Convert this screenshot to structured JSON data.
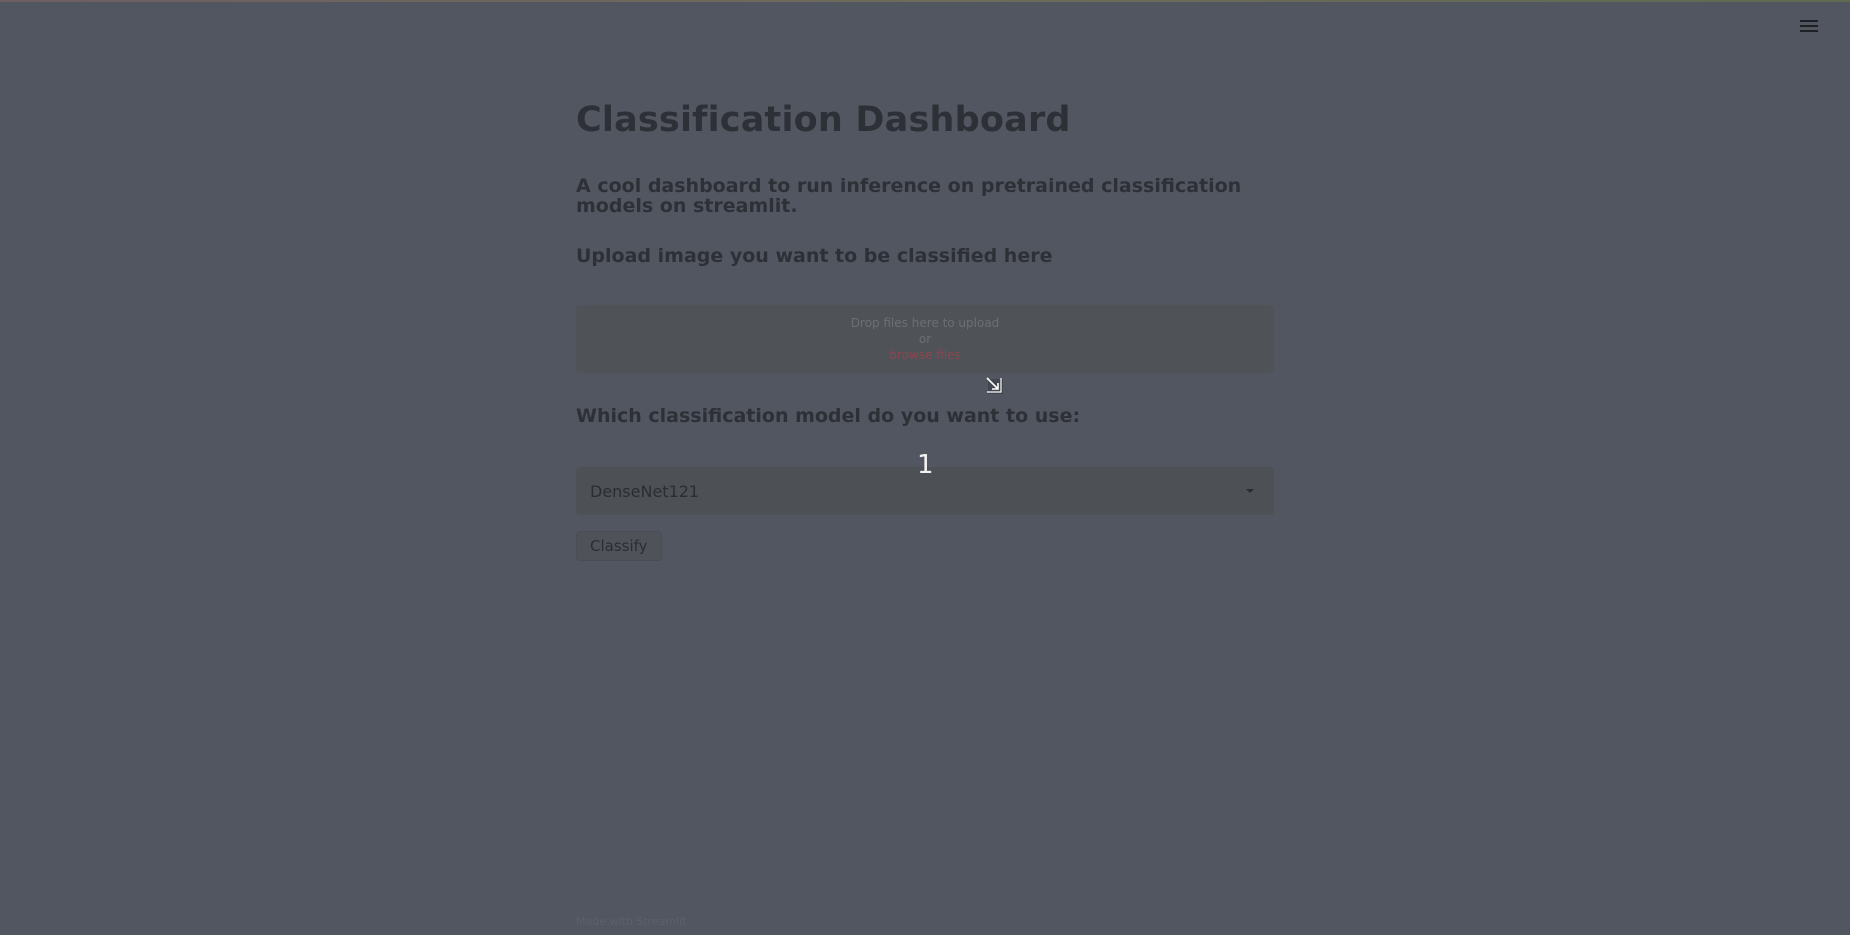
{
  "menu": {
    "icon": "hamburger-menu-icon"
  },
  "header": {
    "title": "Classification Dashboard"
  },
  "main": {
    "subtitle": "A cool dashboard to run inference on pretrained classification models on streamlit.",
    "upload_label": "Upload image you want to be classified here",
    "uploader": {
      "drop_text": "Drop files here to upload",
      "or_text": "or",
      "browse_text": "browse files"
    },
    "model_label": "Which classification model do you want to use:",
    "model_select": {
      "value": "DenseNet121",
      "icon": "chevron-down-icon"
    },
    "classify_label": "Classify"
  },
  "footer": {
    "text": "Made with Streamlit"
  },
  "overlay": {
    "step_number": "1",
    "cursor_icon": "resize-cursor-icon"
  },
  "colors": {
    "background": "#525660",
    "text": "#2e3037",
    "browse_link": "#8a4750"
  }
}
